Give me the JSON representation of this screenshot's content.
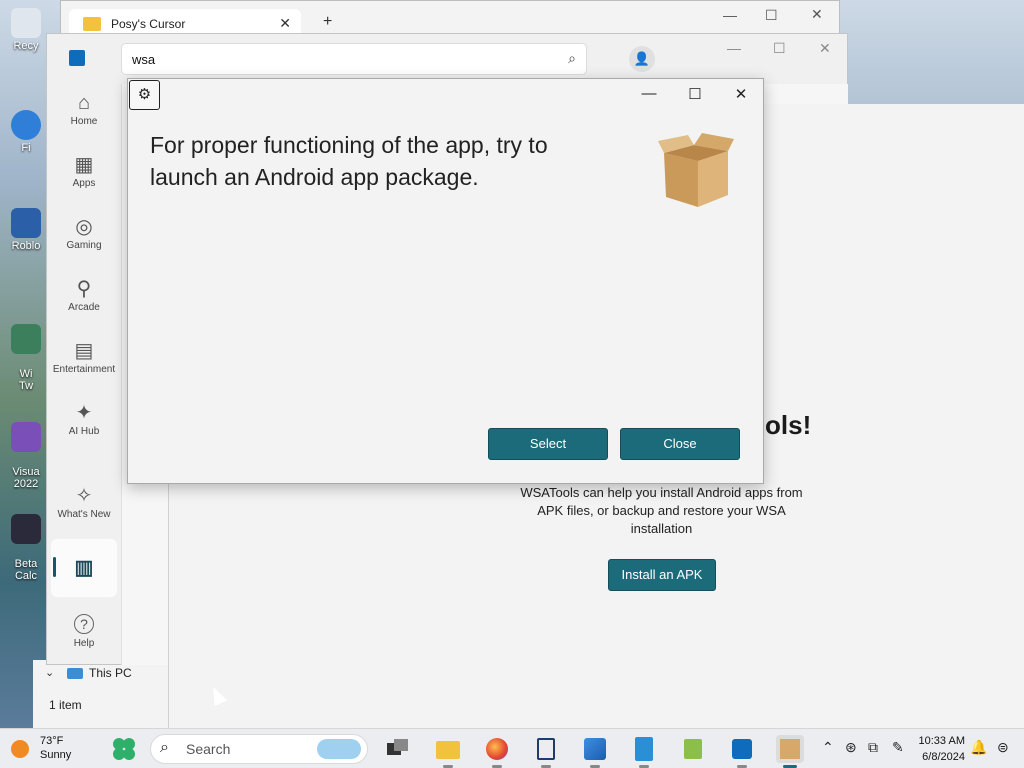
{
  "desktop": {
    "icons": [
      {
        "label": "Recy"
      },
      {
        "label": "Fi"
      },
      {
        "label": "Roblo"
      },
      {
        "label": "Wi\nTw"
      },
      {
        "label": "Visua\n2022"
      },
      {
        "label": "Beta\nCalc"
      }
    ]
  },
  "explorer": {
    "tab_title": "Posy's Cursor",
    "tree_item": "This PC",
    "status": "1 item"
  },
  "store": {
    "search_value": "wsa",
    "nav": [
      {
        "label": "Home",
        "icon": "home-icon",
        "glyph": "⌂"
      },
      {
        "label": "Apps",
        "icon": "apps-icon",
        "glyph": "▦"
      },
      {
        "label": "Gaming",
        "icon": "gamepad-icon",
        "glyph": "◎"
      },
      {
        "label": "Arcade",
        "icon": "joystick-icon",
        "glyph": "⚲"
      },
      {
        "label": "Entertainment",
        "icon": "clapperboard-icon",
        "glyph": "▤"
      },
      {
        "label": "AI Hub",
        "icon": "sparkle-icon",
        "glyph": "✦"
      },
      {
        "label": "What's New",
        "icon": "party-icon",
        "glyph": "✧"
      },
      {
        "label": "",
        "icon": "library-icon",
        "glyph": "▥"
      },
      {
        "label": "Help",
        "icon": "help-icon",
        "glyph": "?"
      }
    ]
  },
  "wsatools": {
    "hero_fragment": "ols!",
    "description": "WSATools can help you install Android apps from APK files, or backup and restore your WSA installation",
    "install_button": "Install an APK"
  },
  "dialog": {
    "message": "For proper functioning of the app, try to launch an Android app package.",
    "select_button": "Select",
    "close_button": "Close"
  },
  "taskbar": {
    "weather_temp": "73°F",
    "weather_desc": "Sunny",
    "search_placeholder": "Search",
    "time": "10:33 AM",
    "date": "6/8/2024"
  },
  "colors": {
    "accent": "#1c6b7a",
    "weather_sun": "#f08a24"
  }
}
